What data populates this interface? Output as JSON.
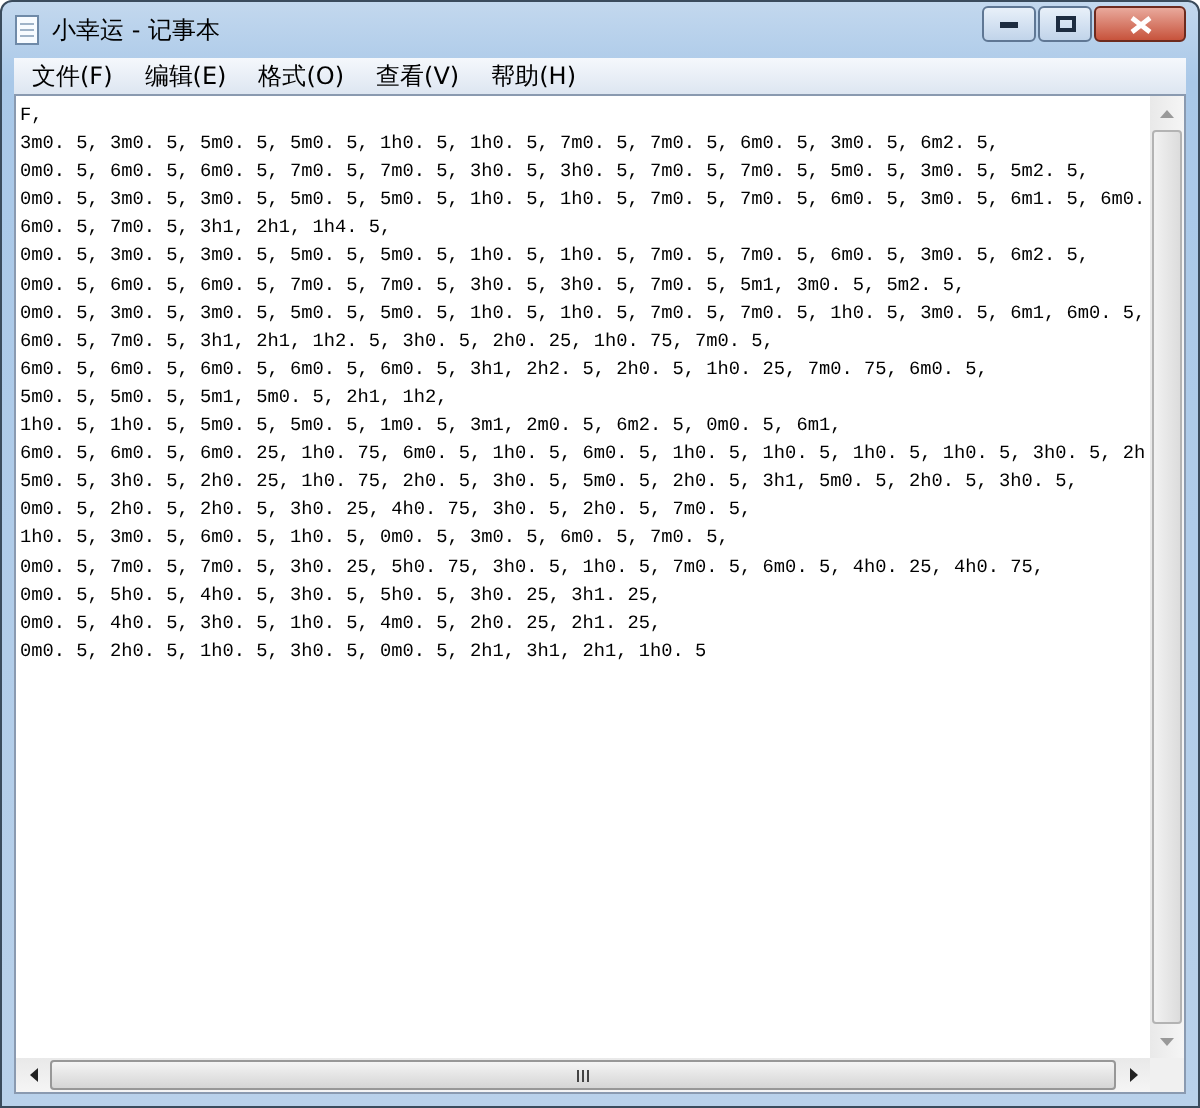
{
  "window": {
    "title": "小幸运 - 记事本"
  },
  "menu": [
    "文件(F)",
    "编辑(E)",
    "格式(O)",
    "查看(V)",
    "帮助(H)"
  ],
  "document": {
    "lines": [
      "F,",
      "3m0. 5, 3m0. 5, 5m0. 5, 5m0. 5, 1h0. 5, 1h0. 5, 7m0. 5, 7m0. 5, 6m0. 5, 3m0. 5, 6m2. 5,",
      "0m0. 5, 6m0. 5, 6m0. 5, 7m0. 5, 7m0. 5, 3h0. 5, 3h0. 5, 7m0. 5, 7m0. 5, 5m0. 5, 3m0. 5, 5m2. 5,",
      "0m0. 5, 3m0. 5, 3m0. 5, 5m0. 5, 5m0. 5, 1h0. 5, 1h0. 5, 7m0. 5, 7m0. 5, 6m0. 5, 3m0. 5, 6m1. 5, 6m0.",
      "6m0. 5, 7m0. 5, 3h1, 2h1, 1h4. 5,",
      "0m0. 5, 3m0. 5, 3m0. 5, 5m0. 5, 5m0. 5, 1h0. 5, 1h0. 5, 7m0. 5, 7m0. 5, 6m0. 5, 3m0. 5, 6m2. 5,",
      "0m0. 5, 6m0. 5, 6m0. 5, 7m0. 5, 7m0. 5, 3h0. 5, 3h0. 5, 7m0. 5, 5m1, 3m0. 5, 5m2. 5,",
      "0m0. 5, 3m0. 5, 3m0. 5, 5m0. 5, 5m0. 5, 1h0. 5, 1h0. 5, 7m0. 5, 7m0. 5, 1h0. 5, 3m0. 5, 6m1, 6m0. 5,",
      "6m0. 5, 7m0. 5, 3h1, 2h1, 1h2. 5, 3h0. 5, 2h0. 25, 1h0. 75, 7m0. 5,",
      "6m0. 5, 6m0. 5, 6m0. 5, 6m0. 5, 6m0. 5, 3h1, 2h2. 5, 2h0. 5, 1h0. 25, 7m0. 75, 6m0. 5,",
      "5m0. 5, 5m0. 5, 5m1, 5m0. 5, 2h1, 1h2,",
      "1h0. 5, 1h0. 5, 5m0. 5, 5m0. 5, 1m0. 5, 3m1, 2m0. 5, 6m2. 5, 0m0. 5, 6m1,",
      "6m0. 5, 6m0. 5, 6m0. 25, 1h0. 75, 6m0. 5, 1h0. 5, 6m0. 5, 1h0. 5, 1h0. 5, 1h0. 5, 1h0. 5, 3h0. 5, 2h",
      "5m0. 5, 3h0. 5, 2h0. 25, 1h0. 75, 2h0. 5, 3h0. 5, 5m0. 5, 2h0. 5, 3h1, 5m0. 5, 2h0. 5, 3h0. 5,",
      "0m0. 5, 2h0. 5, 2h0. 5, 3h0. 25, 4h0. 75, 3h0. 5, 2h0. 5, 7m0. 5,",
      "1h0. 5, 3m0. 5, 6m0. 5, 1h0. 5, 0m0. 5, 3m0. 5, 6m0. 5, 7m0. 5,",
      "0m0. 5, 7m0. 5, 7m0. 5, 3h0. 25, 5h0. 75, 3h0. 5, 1h0. 5, 7m0. 5, 6m0. 5, 4h0. 25, 4h0. 75,",
      "0m0. 5, 5h0. 5, 4h0. 5, 3h0. 5, 5h0. 5, 3h0. 25, 3h1. 25,",
      "0m0. 5, 4h0. 5, 3h0. 5, 1h0. 5, 4m0. 5, 2h0. 25, 2h1. 25,",
      "0m0. 5, 2h0. 5, 1h0. 5, 3h0. 5, 0m0. 5, 2h1, 3h1, 2h1, 1h0. 5"
    ]
  }
}
